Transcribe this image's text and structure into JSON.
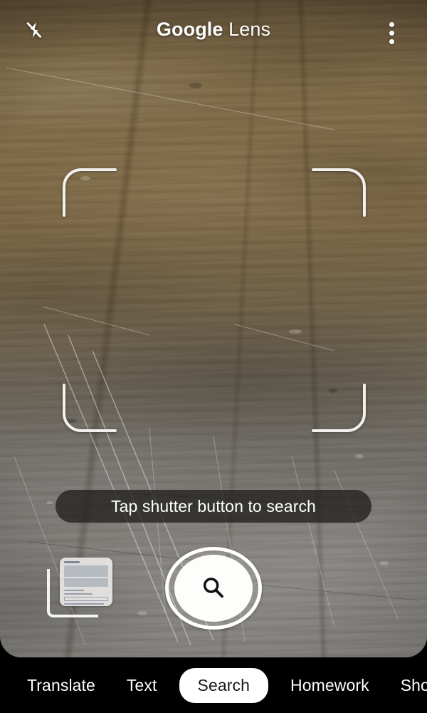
{
  "header": {
    "title_bold": "Google",
    "title_light": " Lens",
    "flash_icon": "flash-off-icon",
    "more_icon": "more-vertical-icon"
  },
  "viewfinder": {
    "hint_text": "Tap shutter button to search",
    "bracket_icon": "focus-corner-bracket-icon"
  },
  "controls": {
    "gallery_thumbnail_label": "",
    "gallery_icon": "gallery-thumbnail-icon",
    "shutter_icon": "search-icon",
    "shutter_label": ""
  },
  "bottom_nav": {
    "items": [
      {
        "label": "Translate",
        "active": false
      },
      {
        "label": "Text",
        "active": false
      },
      {
        "label": "Search",
        "active": true
      },
      {
        "label": "Homework",
        "active": false
      },
      {
        "label": "Shop",
        "active": false
      }
    ]
  },
  "colors": {
    "nav_background": "#000000",
    "active_pill": "#ffffff",
    "active_text": "#17181a",
    "text": "#ffffff",
    "tooltip_background": "rgba(32,30,27,0.76)",
    "shutter_white": "#fdfdfb"
  }
}
